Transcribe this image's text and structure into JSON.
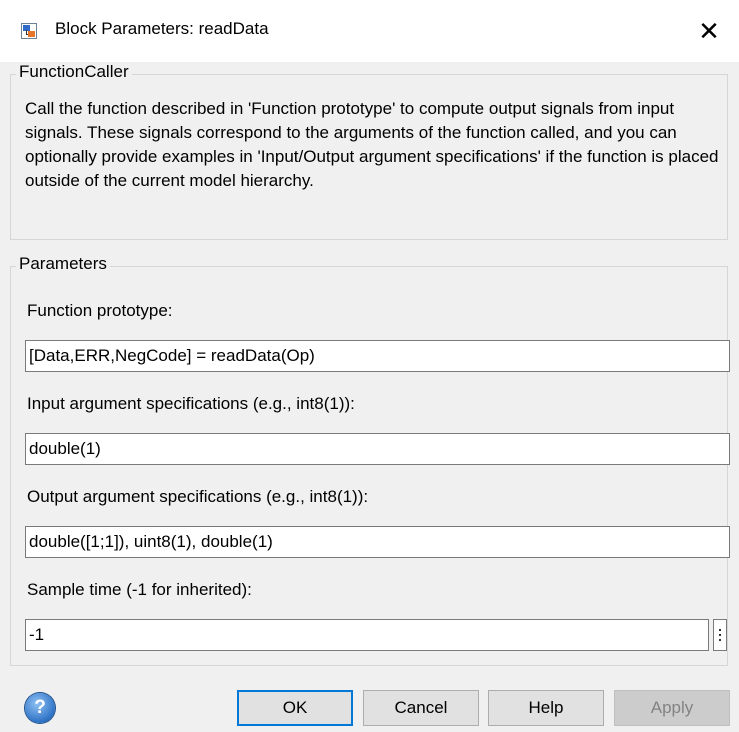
{
  "window": {
    "title": "Block Parameters: readData",
    "close_glyph": "✕",
    "icon": "simulink-block-icon"
  },
  "function_caller": {
    "legend": "FunctionCaller",
    "description": "Call the function described in 'Function prototype' to compute output signals from input signals. These signals correspond to the arguments of the function called, and you can optionally provide examples in 'Input/Output argument specifications' if the function is placed outside of the current model hierarchy."
  },
  "parameters": {
    "legend": "Parameters",
    "prototype_label": "Function prototype:",
    "prototype_value": "[Data,ERR,NegCode] = readData(Op)",
    "input_label": "Input argument specifications (e.g., int8(1)):",
    "input_value": "double(1)",
    "output_label": "Output argument specifications (e.g., int8(1)):",
    "output_value": "double([1;1]), uint8(1), double(1)",
    "sample_label": "Sample time (-1 for inherited):",
    "sample_value": "-1",
    "sample_menu_icon": "vertical-ellipsis-icon"
  },
  "buttons": {
    "help_icon": "?",
    "ok": "OK",
    "cancel": "Cancel",
    "help": "Help",
    "apply": "Apply"
  },
  "colors": {
    "ok_border": "#0078d7",
    "background": "#f0f0f0",
    "disabled_text": "#838383"
  }
}
